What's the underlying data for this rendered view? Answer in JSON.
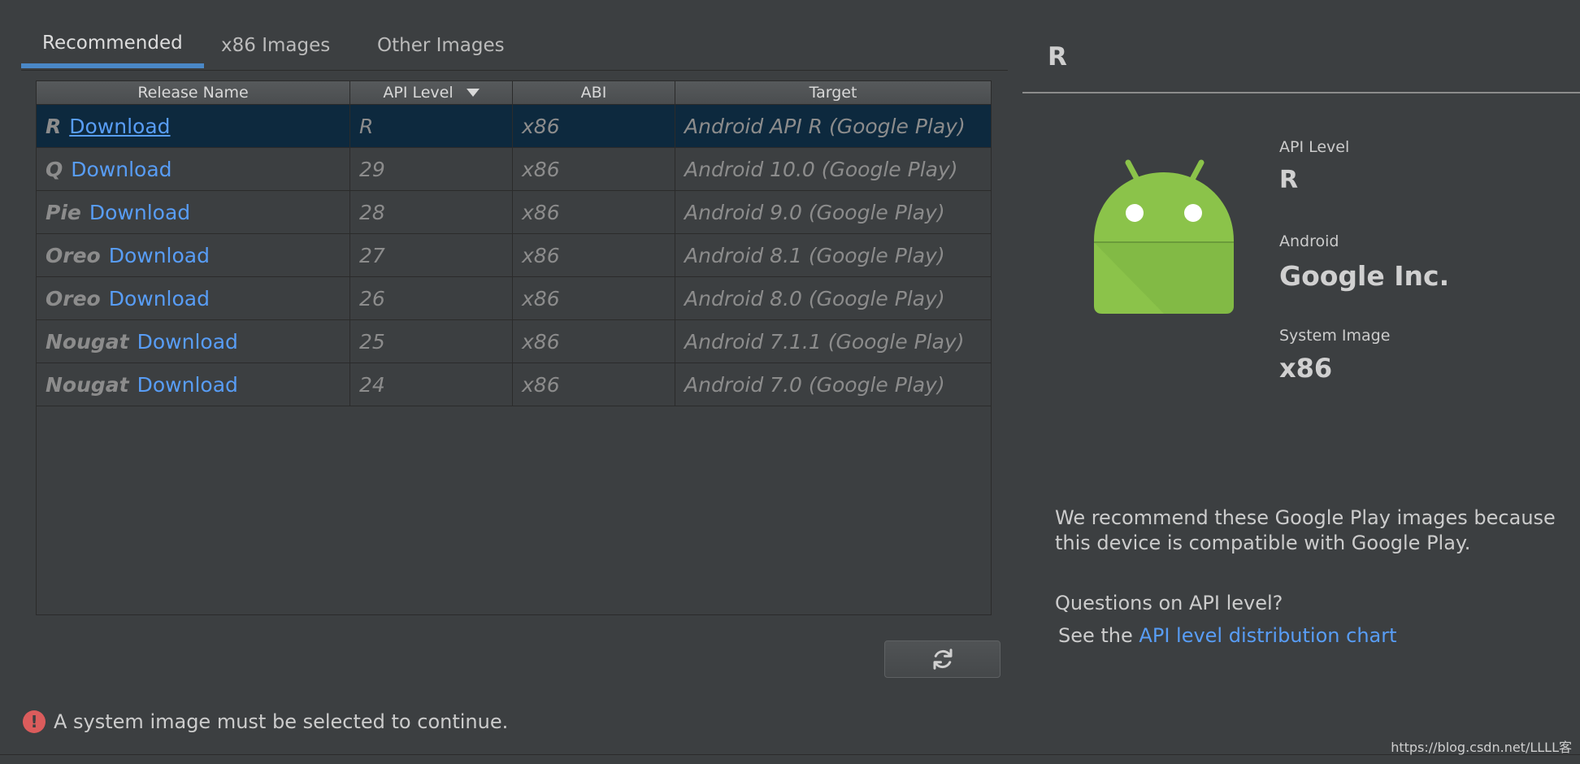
{
  "tabs": [
    {
      "label": "Recommended",
      "active": true
    },
    {
      "label": "x86 Images",
      "active": false
    },
    {
      "label": "Other Images",
      "active": false
    }
  ],
  "table": {
    "columns": [
      "Release Name",
      "API Level",
      "ABI",
      "Target"
    ],
    "sorted_column": "API Level",
    "rows": [
      {
        "release": "R",
        "action": "Download",
        "api": "R",
        "abi": "x86",
        "target": "Android API R (Google Play)",
        "selected": true
      },
      {
        "release": "Q",
        "action": "Download",
        "api": "29",
        "abi": "x86",
        "target": "Android 10.0 (Google Play)",
        "selected": false
      },
      {
        "release": "Pie",
        "action": "Download",
        "api": "28",
        "abi": "x86",
        "target": "Android 9.0 (Google Play)",
        "selected": false
      },
      {
        "release": "Oreo",
        "action": "Download",
        "api": "27",
        "abi": "x86",
        "target": "Android 8.1 (Google Play)",
        "selected": false
      },
      {
        "release": "Oreo",
        "action": "Download",
        "api": "26",
        "abi": "x86",
        "target": "Android 8.0 (Google Play)",
        "selected": false
      },
      {
        "release": "Nougat",
        "action": "Download",
        "api": "25",
        "abi": "x86",
        "target": "Android 7.1.1 (Google Play)",
        "selected": false
      },
      {
        "release": "Nougat",
        "action": "Download",
        "api": "24",
        "abi": "x86",
        "target": "Android 7.0 (Google Play)",
        "selected": false
      }
    ]
  },
  "refresh_icon": "refresh-icon",
  "error": {
    "icon": "error-icon",
    "glyph": "!",
    "text": "A system image must be selected to continue."
  },
  "details": {
    "title": "R",
    "api_level_label": "API Level",
    "api_level_value": "R",
    "android_label": "Android",
    "android_value": "Google Inc.",
    "system_image_label": "System Image",
    "system_image_value": "x86",
    "recommend_text": "We recommend these Google Play images because this device is compatible with Google Play.",
    "questions_text": "Questions on API level?",
    "see_prefix": "See the ",
    "chart_link": "API level distribution chart"
  },
  "watermark": "https://blog.csdn.net/LLLL客",
  "colors": {
    "background": "#3c3f41",
    "selected_row": "#0d293e",
    "link": "#589df6",
    "tab_underline": "#4a88c7",
    "error": "#db5c5c",
    "android_green": "#8bc34a"
  }
}
